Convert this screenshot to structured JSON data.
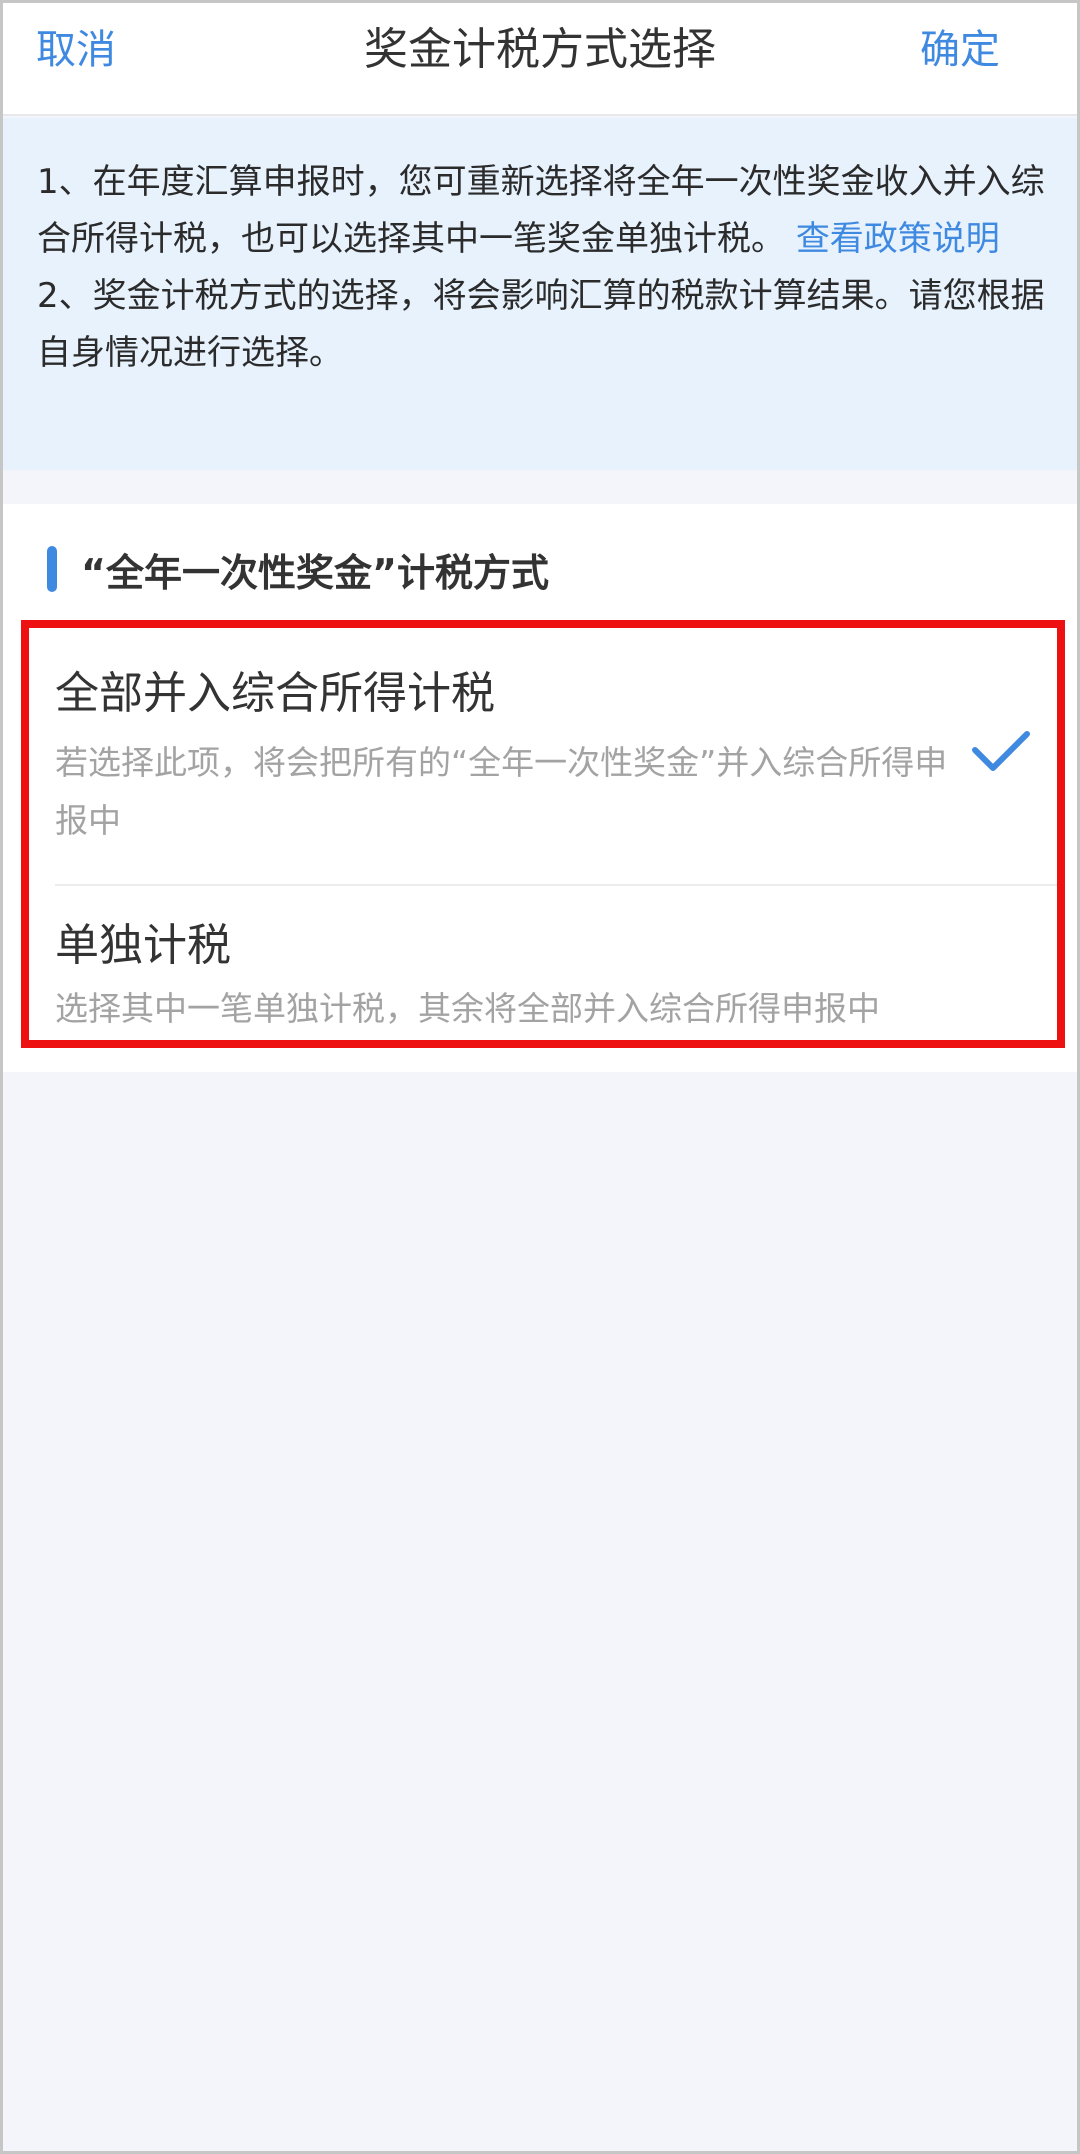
{
  "navbar": {
    "cancel_label": "取消",
    "title": "奖金计税方式选择",
    "confirm_label": "确定"
  },
  "notice": {
    "line1_text": "1、在年度汇算申报时，您可重新选择将全年一次性奖金收入并入综合所得计税，也可以选择其中一笔奖金单独计税。",
    "line1_link": "查看政策说明",
    "line2_text": "2、奖金计税方式的选择，将会影响汇算的税款计算结果。请您根据自身情况进行选择。"
  },
  "section": {
    "title": "“全年一次性奖金”计税方式",
    "options": [
      {
        "title": "全部并入综合所得计税",
        "description": "若选择此项，将会把所有的“全年一次性奖金”并入综合所得申报中",
        "selected": true
      },
      {
        "title": "单独计税",
        "description": "选择其中一笔单独计税，其余将全部并入综合所得申报中",
        "selected": false
      }
    ]
  },
  "colors": {
    "accent": "#3f8ae0",
    "highlight_border": "#ee1111",
    "notice_bg": "#e7f2fd",
    "page_bg": "#f3f5fa"
  },
  "icons": {
    "selected_marker": "check-icon"
  }
}
